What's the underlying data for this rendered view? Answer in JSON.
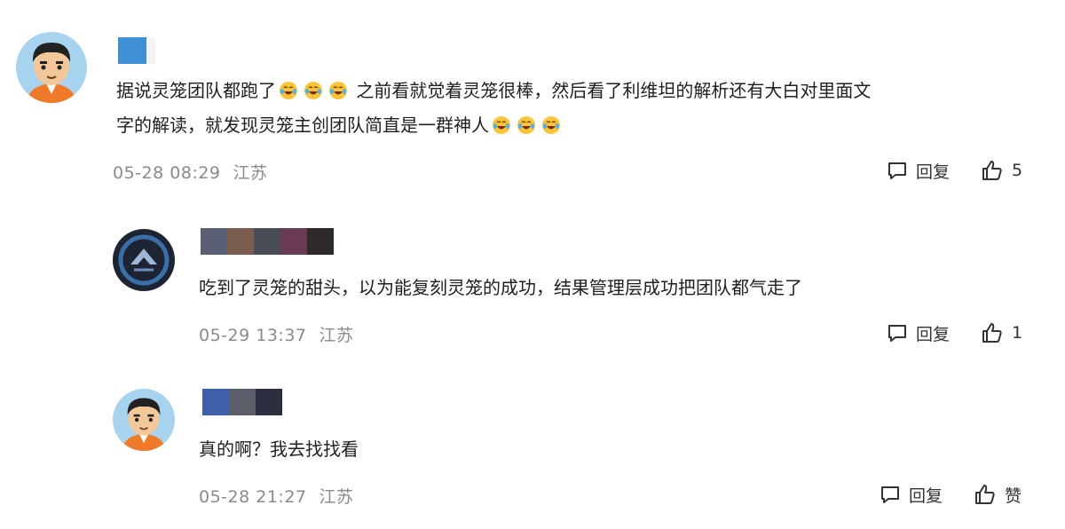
{
  "comments": [
    {
      "text_before_emoji": "据说灵笼团队都跑了",
      "text_after_emoji": "之前看就觉着灵笼很棒，然后看了利维坦的解析还有大白对里面文",
      "text_line2": "字的解读，就发现灵笼主创团队简直是一群神人",
      "emoji_name": "laugh-cry-emoji",
      "date": "05-28 08:29",
      "location": "江苏",
      "reply_label": "回复",
      "like_count": "5"
    },
    {
      "text": "吃到了灵笼的甜头，以为能复刻灵笼的成功，结果管理层成功把团队都气走了",
      "date": "05-29 13:37",
      "location": "江苏",
      "reply_label": "回复",
      "like_count": "1"
    },
    {
      "text": "真的啊？我去找找看",
      "date": "05-28 21:27",
      "location": "江苏",
      "reply_label": "回复",
      "like_label": "赞"
    }
  ],
  "icons": {
    "reply": "comment-bubble-icon",
    "like": "thumbs-up-icon"
  },
  "colors": {
    "meta_text": "#8a8a8a",
    "body_text": "#1f1f1f"
  }
}
